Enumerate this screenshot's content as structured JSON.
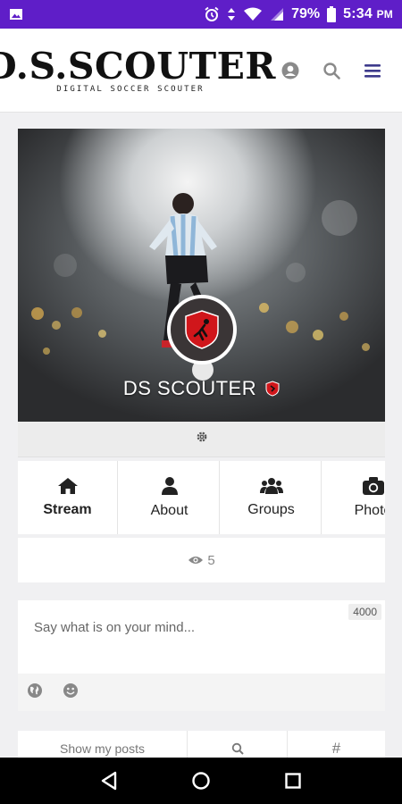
{
  "status_bar": {
    "battery_text": "79%",
    "time": "5:34",
    "time_suffix": "PM",
    "icons": [
      "image-icon",
      "alarm-icon",
      "data-arrows-icon",
      "wifi-icon",
      "signal-icon",
      "battery-icon"
    ],
    "background": "#5f1ec8"
  },
  "header": {
    "logo_text": "D.S.SCOUTER",
    "logo_tagline": "DIGITAL SOCCER SCOUTER",
    "icons": [
      "user-icon",
      "search-icon",
      "menu-icon"
    ],
    "accent": "#3d3a8c"
  },
  "profile": {
    "name": "DS SCOUTER",
    "emblem_color": "#d0161b"
  },
  "tabs": [
    {
      "label": "Stream",
      "icon": "home-icon",
      "active": true
    },
    {
      "label": "About",
      "icon": "user-icon",
      "active": false
    },
    {
      "label": "Groups",
      "icon": "users-icon",
      "active": false
    },
    {
      "label": "Photo",
      "icon": "camera-icon",
      "active": false
    }
  ],
  "views": {
    "count": "5",
    "icon": "eye-icon"
  },
  "composer": {
    "placeholder": "Say what is on your mind...",
    "char_limit": "4000",
    "tools": [
      "globe-icon",
      "smile-icon"
    ]
  },
  "filters": [
    {
      "label": "Show my posts"
    },
    {
      "label": "",
      "icon": "search-icon"
    },
    {
      "label": "#",
      "icon": "hashtag-icon"
    }
  ],
  "nav_bar": {
    "buttons": [
      "back-icon",
      "home-circle-icon",
      "recents-icon"
    ]
  }
}
